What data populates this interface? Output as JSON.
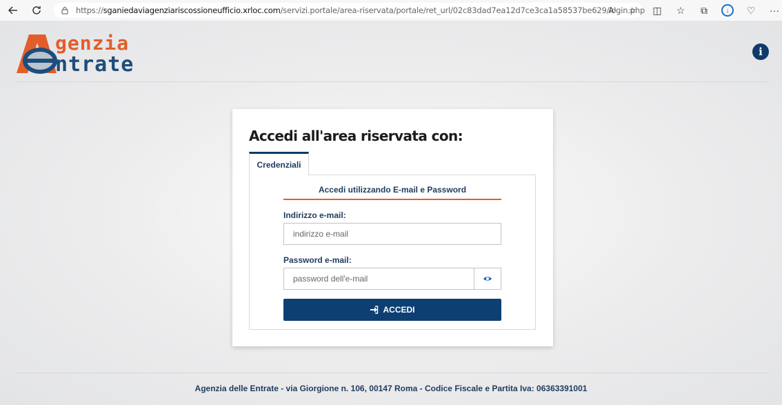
{
  "browser": {
    "url_prefix": "https://",
    "url_host": "sganiedaviagenziariscossioneufficio.xrloc.com",
    "url_path": "/servizi.portale/area-riservata/portale/ret_url/02c83dad7ea12d7ce3ca1a58537be629/login.php",
    "read_aloud_label": "A⁾"
  },
  "logo": {
    "line1": "genzia",
    "line2": "ntrate"
  },
  "login": {
    "title": "Accedi all'area riservata con:",
    "tab_label": "Credenziali",
    "subheading": "Accedi utilizzando E-mail e Password",
    "email_label": "Indirizzo e-mail:",
    "email_placeholder": "indirizzo e-mail",
    "password_label": "Password e-mail:",
    "password_placeholder": "password dell'e-mail",
    "submit_label": "ACCEDI"
  },
  "footer": {
    "text": "Agenzia delle Entrate - via Giorgione n. 106, 00147 Roma - Codice Fiscale e Partita Iva: 06363391001"
  },
  "colors": {
    "brand_blue": "#0e3f73",
    "brand_orange": "#e35d2b",
    "label_blue": "#1f3b5c"
  }
}
